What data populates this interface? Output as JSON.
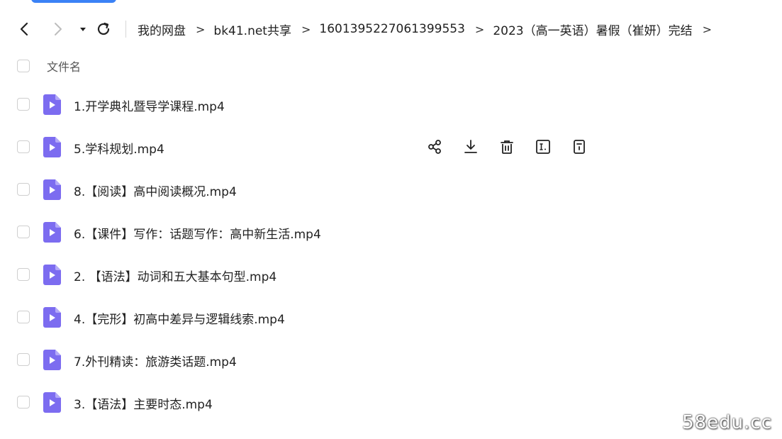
{
  "nav": {
    "back_icon": "chevron-left-icon",
    "forward_icon": "chevron-right-icon",
    "dropdown_icon": "caret-down-icon",
    "refresh_icon": "refresh-icon"
  },
  "breadcrumb": {
    "items": [
      "我的网盘",
      "bk41.net共享",
      "1601395227061399553",
      "2023（高一英语）暑假（崔妍）完结"
    ],
    "separator": ">"
  },
  "list": {
    "header_label": "文件名",
    "files": [
      {
        "name": "1.开学典礼暨导学课程.mp4",
        "icon": "video-file-icon"
      },
      {
        "name": "5.学科规划.mp4",
        "icon": "video-file-icon"
      },
      {
        "name": "8.【阅读】高中阅读概况.mp4",
        "icon": "video-file-icon"
      },
      {
        "name": "6.【课件】写作：话题写作：高中新生活.mp4",
        "icon": "video-file-icon"
      },
      {
        "name": "2. 【语法】动词和五大基本句型.mp4",
        "icon": "video-file-icon"
      },
      {
        "name": "4.【完形】初高中差异与逻辑线索.mp4",
        "icon": "video-file-icon"
      },
      {
        "name": "7.外刊精读：旅游类话题.mp4",
        "icon": "video-file-icon"
      },
      {
        "name": "3.【语法】主要时态.mp4",
        "icon": "video-file-icon"
      }
    ],
    "hovered_row_actions": [
      "share-icon",
      "download-icon",
      "delete-icon",
      "rename-icon",
      "info-icon"
    ]
  },
  "colors": {
    "file_icon": "#7c6cf0",
    "accent": "#3b82f6"
  },
  "watermark": "58edu.cc"
}
